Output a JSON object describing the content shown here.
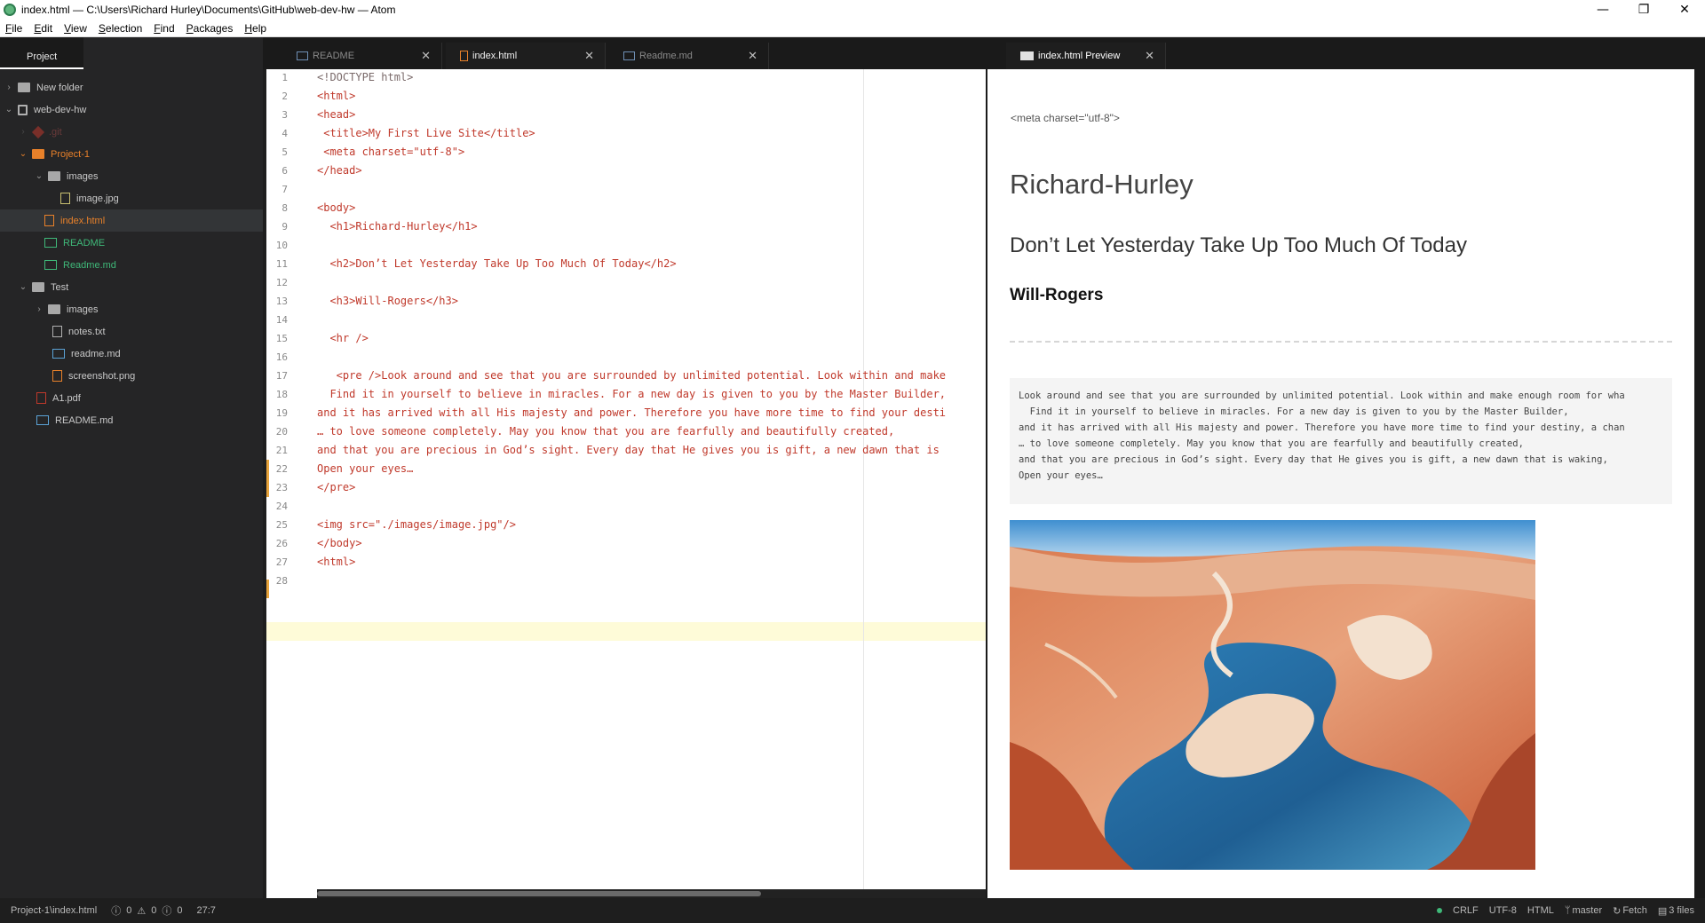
{
  "window": {
    "title": "index.html — C:\\Users\\Richard Hurley\\Documents\\GitHub\\web-dev-hw — Atom",
    "controls": [
      "—",
      "❐",
      "✕"
    ]
  },
  "menu": [
    "File",
    "Edit",
    "View",
    "Selection",
    "Find",
    "Packages",
    "Help"
  ],
  "sidebar": {
    "header": "Project",
    "items": [
      {
        "label": "New folder",
        "chevron": "›"
      },
      {
        "label": "web-dev-hw",
        "chevron": "⌄"
      },
      {
        "label": ".git",
        "chevron": "›"
      },
      {
        "label": "Project-1",
        "chevron": "⌄"
      },
      {
        "label": "images",
        "chevron": "⌄"
      },
      {
        "label": "image.jpg",
        "chevron": ""
      },
      {
        "label": "index.html",
        "chevron": ""
      },
      {
        "label": "README",
        "chevron": ""
      },
      {
        "label": "Readme.md",
        "chevron": ""
      },
      {
        "label": "Test",
        "chevron": "⌄"
      },
      {
        "label": "images",
        "chevron": "›"
      },
      {
        "label": "notes.txt",
        "chevron": ""
      },
      {
        "label": "readme.md",
        "chevron": ""
      },
      {
        "label": "screenshot.png",
        "chevron": ""
      },
      {
        "label": "A1.pdf",
        "chevron": ""
      },
      {
        "label": "README.md",
        "chevron": ""
      }
    ]
  },
  "tabs": [
    {
      "label": "README",
      "close": "✕"
    },
    {
      "label": "index.html",
      "close": "✕"
    },
    {
      "label": "Readme.md",
      "close": "✕"
    },
    {
      "label": "index.html Preview",
      "close": "✕"
    }
  ],
  "editor": {
    "line_numbers": [
      "1",
      "2",
      "3",
      "4",
      "5",
      "6",
      "7",
      "8",
      "9",
      "10",
      "11",
      "12",
      "13",
      "14",
      "15",
      "16",
      "17",
      "18",
      "19",
      "20",
      "21",
      "22",
      "23",
      "24",
      "25",
      "26",
      "27",
      "28"
    ],
    "lines": [
      "<!DOCTYPE html>",
      "<html>",
      "<head>",
      " <title>My First Live Site</title>",
      " <meta charset=\"utf-8\">",
      "</head>",
      "",
      "<body>",
      "  <h1>Richard-Hurley</h1>",
      "",
      "  <h2>Don’t Let Yesterday Take Up Too Much Of Today</h2>",
      "",
      "  <h3>Will-Rogers</h3>",
      "",
      "  <hr />",
      "",
      "   <pre />Look around and see that you are surrounded by unlimited potential. Look within and make",
      "  Find it in yourself to believe in miracles. For a new day is given to you by the Master Builder,",
      "and it has arrived with all His majesty and power. Therefore you have more time to find your desti",
      "… to love someone completely. May you know that you are fearfully and beautifully created,",
      "and that you are precious in God’s sight. Every day that He gives you is gift, a new dawn that is",
      "Open your eyes…",
      "</pre>",
      "",
      "<img src=\"./images/image.jpg\"/>",
      "</body>",
      "<html>",
      ""
    ]
  },
  "preview": {
    "meta": "<meta charset=\"utf-8\">",
    "h1": "Richard-Hurley",
    "h2": "Don’t Let Yesterday Take Up Too Much Of Today",
    "h3": "Will-Rogers",
    "pre": [
      "Look around and see that you are surrounded by unlimited potential. Look within and make enough room for wha",
      "  Find it in yourself to believe in miracles. For a new day is given to you by the Master Builder,",
      "and it has arrived with all His majesty and power. Therefore you have more time to find your destiny, a chan",
      "… to love someone completely. May you know that you are fearfully and beautifully created,",
      "and that you are precious in God’s sight. Every day that He gives you is gift, a new dawn that is waking,",
      "Open your eyes…"
    ]
  },
  "status": {
    "path": "Project-1\\index.html",
    "errors": "0",
    "warnings": "0",
    "infos": "0",
    "cursor": "27:7",
    "line_ending": "CRLF",
    "encoding": "UTF-8",
    "grammar": "HTML",
    "branch": "master",
    "fetch": "Fetch",
    "files": "3 files"
  }
}
